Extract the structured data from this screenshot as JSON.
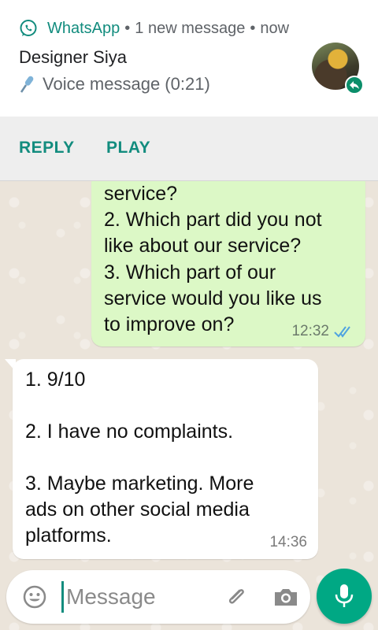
{
  "notification": {
    "app_name": "WhatsApp",
    "separator": "•",
    "new_message_text": "1 new message",
    "time": "now",
    "sender": "Designer Siya",
    "preview": "Voice message (0:21)",
    "app_icon": "whatsapp-icon",
    "avatar_icon": "contact-avatar",
    "accent_color": "#128c7e"
  },
  "actions": {
    "reply_label": "REPLY",
    "play_label": "PLAY"
  },
  "messages": {
    "outgoing": {
      "lines": [
        "service?",
        "2. Which part did you not",
        "like about our service?",
        "3. Which part of our",
        "service would you like us",
        "to improve on?"
      ],
      "time": "12:32",
      "status_icon": "double-check-read-icon",
      "bubble_color": "#dcf8c6"
    },
    "incoming": {
      "lines": [
        "1. 9/10",
        "",
        "2. I have no complaints.",
        "",
        "3. Maybe marketing. More",
        "ads on other social media",
        "platforms."
      ],
      "time": "14:36",
      "bubble_color": "#ffffff"
    }
  },
  "composer": {
    "placeholder": "Message",
    "icons": [
      "emoji-icon",
      "paperclip-icon",
      "camera-icon",
      "microphone-icon"
    ],
    "send_button_color": "#00a884"
  }
}
